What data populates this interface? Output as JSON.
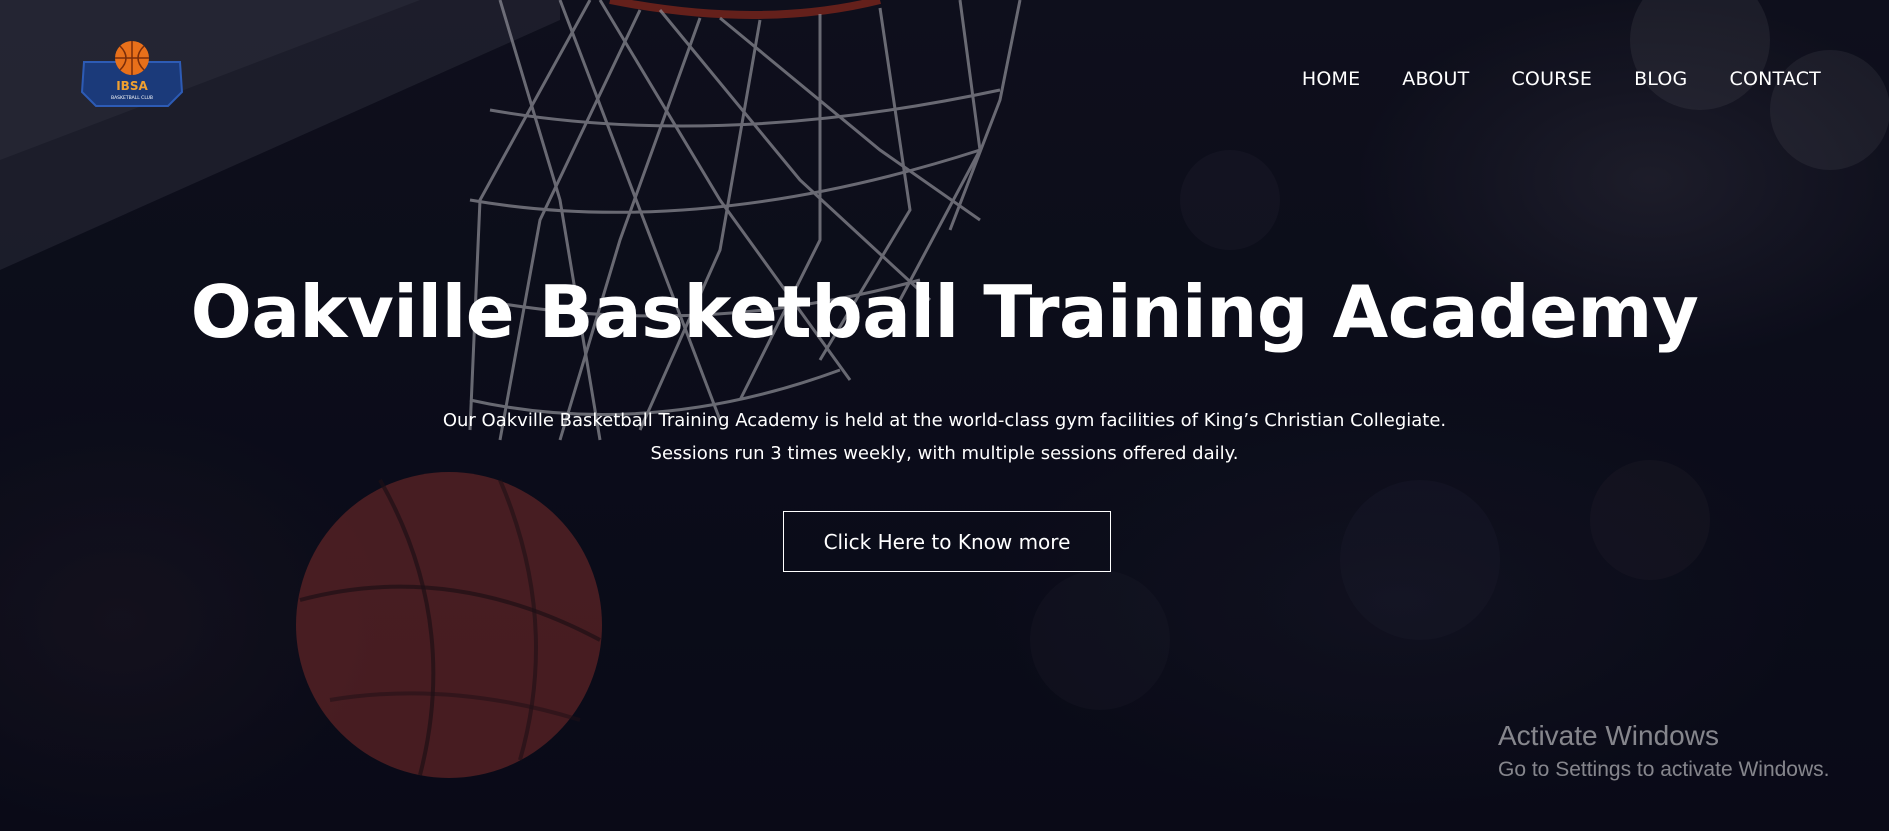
{
  "brand": {
    "logo_text": "IBSA",
    "logo_subtext": "BASKETBALL CLUB",
    "colors": {
      "navy": "#1b3a7a",
      "orange": "#e8701a",
      "gold": "#f0a030"
    }
  },
  "nav": {
    "items": [
      {
        "label": "HOME"
      },
      {
        "label": "ABOUT"
      },
      {
        "label": "COURSE"
      },
      {
        "label": "BLOG"
      },
      {
        "label": "CONTACT"
      }
    ]
  },
  "hero": {
    "title": "Oakville Basketball Training Academy",
    "description_line1": "Our Oakville Basketball Training Academy is held at the world-class gym facilities of King’s Christian Collegiate.",
    "description_line2": "Sessions run 3 times weekly, with multiple sessions offered daily.",
    "cta_label": "Click Here to Know more",
    "background": "basketball-hoop-photo"
  },
  "watermark": {
    "title": "Activate Windows",
    "subtitle": "Go to Settings to activate Windows."
  }
}
